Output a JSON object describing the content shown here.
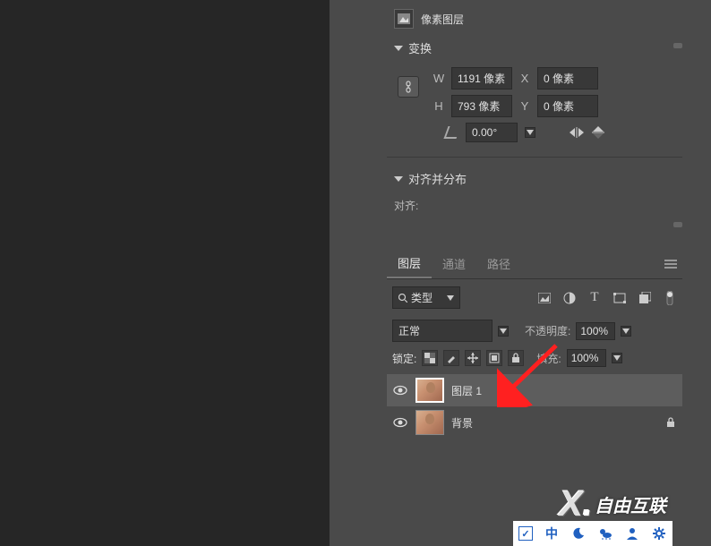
{
  "properties": {
    "pixel_layer_label": "像素图层",
    "transform": {
      "header": "变换",
      "w_label": "W",
      "w_value": "1191 像素",
      "x_label": "X",
      "x_value": "0 像素",
      "h_label": "H",
      "h_value": "793 像素",
      "y_label": "Y",
      "y_value": "0 像素",
      "rotation": "0.00°"
    },
    "align": {
      "header": "对齐并分布",
      "label": "对齐:"
    }
  },
  "layers_panel": {
    "tabs": {
      "layers": "图层",
      "channels": "通道",
      "paths": "路径"
    },
    "type_filter": "类型",
    "blend_mode": "正常",
    "opacity_label": "不透明度:",
    "opacity_value": "100%",
    "lock_label": "锁定:",
    "fill_label": "填充:",
    "fill_value": "100%",
    "layers": [
      {
        "name": "图层 1",
        "selected": true,
        "locked": false
      },
      {
        "name": "背景",
        "selected": false,
        "locked": true
      }
    ]
  },
  "watermark": {
    "text": "自由互联"
  },
  "bottom_bar": {
    "ime": "中"
  }
}
